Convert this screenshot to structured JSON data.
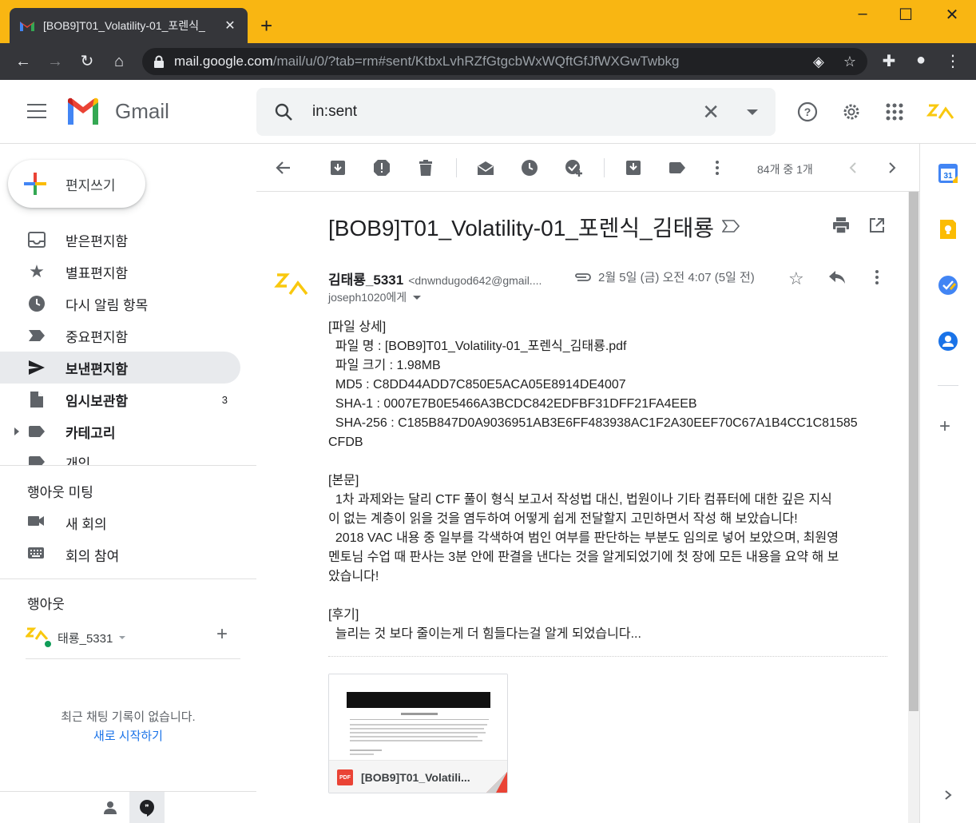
{
  "browser": {
    "tab_title": "[BOB9]T01_Volatility-01_포렌식_",
    "tab_close": "✕",
    "new_tab": "+",
    "url_host": "mail.google.com",
    "url_path": "/mail/u/0/?tab=rm#sent/KtbxLvhRZfGtgcbWxWQftGfJfWXGwTwbkg"
  },
  "header": {
    "brand": "Gmail",
    "search_query": "in:sent",
    "search_clear": "✕"
  },
  "sidebar": {
    "compose_label": "편지쓰기",
    "items": [
      {
        "label": "받은편지함",
        "icon": "inbox-icon"
      },
      {
        "label": "별표편지함",
        "icon": "star-icon"
      },
      {
        "label": "다시 알림 항목",
        "icon": "clock-icon"
      },
      {
        "label": "중요편지함",
        "icon": "important-icon"
      },
      {
        "label": "보낸편지함",
        "icon": "send-icon"
      },
      {
        "label": "임시보관함",
        "icon": "draft-icon",
        "count": "3"
      },
      {
        "label": "카테고리",
        "icon": "label-icon"
      },
      {
        "label": "개인",
        "icon": "label-icon"
      }
    ],
    "meet": {
      "title": "행아웃 미팅",
      "new_meeting": "새 회의",
      "join_meeting": "회의 참여"
    },
    "hangouts": {
      "title": "행아웃",
      "user": "태룡_5331",
      "add": "+",
      "no_chat": "최근 채팅 기록이 없습니다.",
      "start_new": "새로 시작하기"
    }
  },
  "toolbar": {
    "pager": "84개 중 1개"
  },
  "message": {
    "subject": "[BOB9]T01_Volatility-01_포렌식_김태룡",
    "sender_name": "김태룡_5331",
    "sender_email": "<dnwndugod642@gmail....",
    "date": "2월 5일 (금) 오전 4:07 (5일 전)",
    "recipient": "joseph1020에게",
    "body_lines": [
      "[파일 상세]",
      "  파일 명 : [BOB9]T01_Volatility-01_포렌식_김태룡.pdf",
      "  파일 크기 : 1.98MB",
      "  MD5 : C8DD44ADD7C850E5ACA05E8914DE4007",
      "  SHA-1 : 0007E7B0E5466A3BCDC842EDFBF31DFF21FA4EEB",
      "  SHA-256 : C185B847D0A9036951AB3E6FF483938AC1F2A30EEF70C67A1B4CC1C81585",
      "CFDB",
      "",
      "[본문]",
      "  1차 과제와는 달리 CTF 풀이 형식 보고서 작성법 대신, 법원이나 기타 컴퓨터에 대한 깊은 지식",
      "이 없는 계층이 읽을 것을 염두하여 어떻게 쉽게 전달할지 고민하면서 작성 해 보았습니다!",
      "  2018 VAC 내용 중 일부를 각색하여 범인 여부를 판단하는 부분도 임의로 넣어 보았으며, 최원영",
      "멘토님 수업 때 판사는 3분 안에 판결을 낸다는 것을 알게되었기에 첫 장에 모든 내용을 요약 해 보",
      "았습니다!",
      "",
      "[후기]",
      "  늘리는 것 보다 줄이는게 더 힘들다는걸 알게 되었습니다..."
    ],
    "attachment_name": "[BOB9]T01_Volatili...",
    "attachment_badge": "PDF"
  },
  "colors": {
    "chrome_frame": "#f9b612",
    "active_nav": "#e8eaed",
    "link": "#1a73e8"
  }
}
